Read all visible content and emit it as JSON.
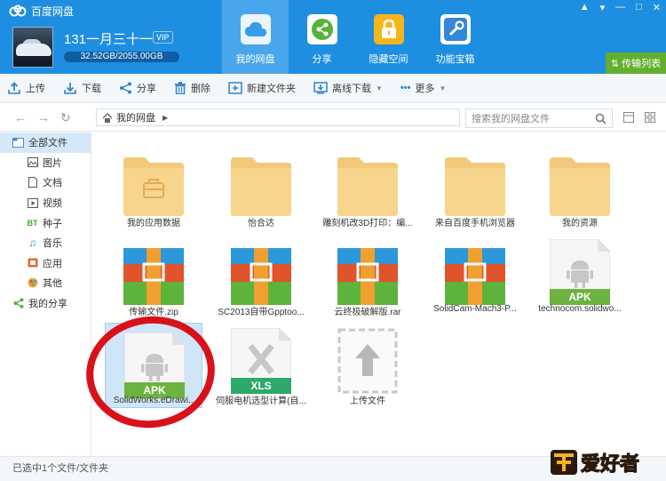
{
  "app": {
    "title": "百度网盘"
  },
  "user": {
    "name": "131一月三十一",
    "vip": "VIP",
    "quota": "32.52GB/2055.00GB"
  },
  "nav_tabs": [
    {
      "label": "我的网盘",
      "icon": "cloud-icon",
      "active": true
    },
    {
      "label": "分享",
      "icon": "share-icon",
      "active": false
    },
    {
      "label": "隐藏空间",
      "icon": "lock-icon",
      "active": false
    },
    {
      "label": "功能宝箱",
      "icon": "toolbox-icon",
      "active": false
    }
  ],
  "transfer_label": "传输列表",
  "toolbar": {
    "upload": "上传",
    "download": "下载",
    "share": "分享",
    "delete": "删除",
    "new_folder": "新建文件夹",
    "offline": "离线下载",
    "more": "更多"
  },
  "address": {
    "path": "我的网盘",
    "search_placeholder": "搜索我的网盘文件"
  },
  "sidebar": {
    "all_files": "全部文件",
    "items": [
      "图片",
      "文档",
      "视频",
      "种子",
      "音乐",
      "应用",
      "其他"
    ],
    "my_share": "我的分享"
  },
  "files": [
    {
      "name": "我的应用数据",
      "type": "folder-app"
    },
    {
      "name": "怡合达",
      "type": "folder"
    },
    {
      "name": "雕刻机改3D打印：编...",
      "type": "folder"
    },
    {
      "name": "来自百度手机浏览器",
      "type": "folder"
    },
    {
      "name": "我的资源",
      "type": "folder"
    },
    {
      "name": "传输文件.zip",
      "type": "zip"
    },
    {
      "name": "SC2013自带Gpptoo...",
      "type": "zip"
    },
    {
      "name": "云终极破解版.rar",
      "type": "zip"
    },
    {
      "name": "SolidCam-Mach3-P...",
      "type": "zip"
    },
    {
      "name": "technocom.solidwo...",
      "type": "apk",
      "badge": "APK"
    },
    {
      "name": "SolidWorks.eDrawi...",
      "type": "apk",
      "badge": "APK",
      "selected": true
    },
    {
      "name": "伺服电机选型计算(自...",
      "type": "xls",
      "badge": "XLS"
    },
    {
      "name": "上传文件",
      "type": "upload"
    }
  ],
  "status": "已选中1个文件/文件夹",
  "watermark": "爱好者",
  "colors": {
    "header": "#1e8fe0",
    "active_tab": "#4aa6ea",
    "transfer": "#64ae2f",
    "folder": "#f7d58d",
    "apk": "#6db33f",
    "xls": "#2fa86b"
  }
}
